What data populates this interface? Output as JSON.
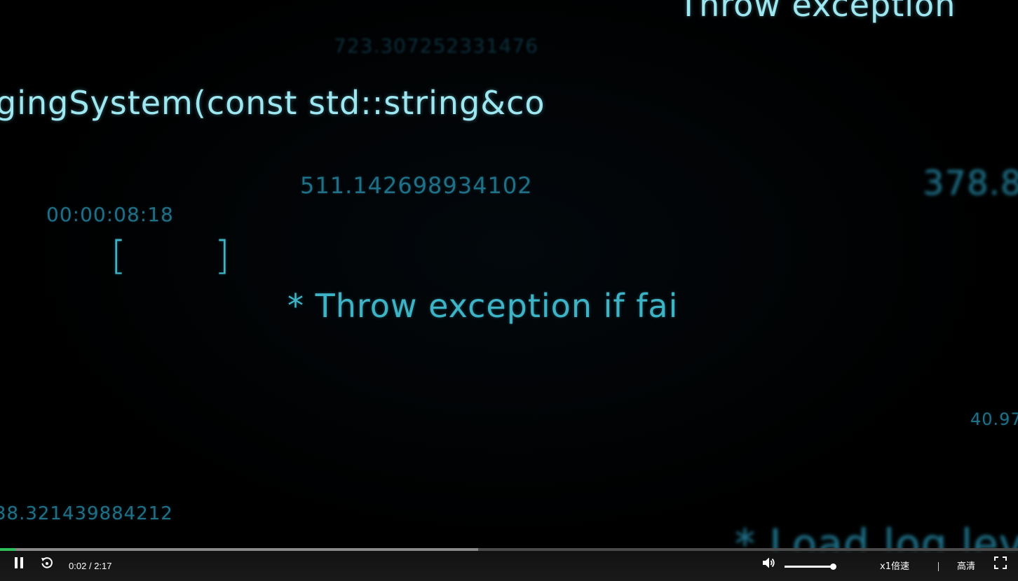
{
  "video": {
    "overlays": {
      "top_right": "Throw exception",
      "faint_top": "723.307252331476",
      "code_line": "gingSystem(const std::string&co",
      "number_center": "511.142698934102",
      "number_right": "378.8",
      "timecode": "00:00:08:18",
      "bracket_left": "[",
      "bracket_right": "]",
      "comment_center": "* Throw exception if fai",
      "number_right_small": "40.97",
      "number_bottom_left": "38.321439884212",
      "comment_bottom": "* Load log lev"
    }
  },
  "controls": {
    "time_current": "0:02",
    "time_separator": "/",
    "time_total": "2:17",
    "progress_played": 0.015,
    "progress_buffered": 0.47,
    "volume_level": 0.96,
    "speed_label": "x1倍速",
    "quality_label": "高清",
    "icons": {
      "play_pause": "pause-icon",
      "replay": "replay-icon",
      "volume": "volume-icon",
      "fullscreen": "fullscreen-icon"
    },
    "colors": {
      "played": "#2fbf5a",
      "buffered": "#8a8a8a",
      "track": "#4a4a4a"
    }
  }
}
